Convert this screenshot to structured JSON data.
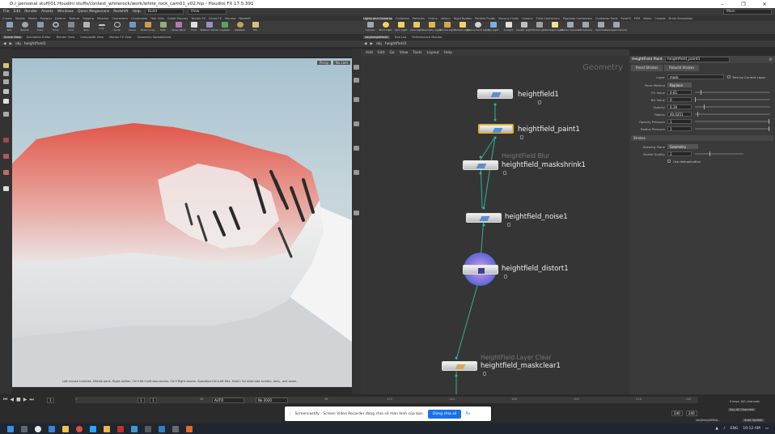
{
  "window": {
    "title": "D:/_personal stuff/01.Houdini stuffs/contest_whiterock/work/white_rock_cam01_v02.hip - Houdini FX 17.5.391",
    "controls": [
      "–",
      "❐",
      "✕"
    ]
  },
  "menubar": {
    "items": [
      "File",
      "Edit",
      "Render",
      "Assets",
      "Windows",
      "Qonsi Megascans",
      "Redshift",
      "Help"
    ],
    "desktop": "Build",
    "view": "View",
    "search": "Main"
  },
  "shelf_left": {
    "tabs": [
      "Create",
      "Modify",
      "Model",
      "Polygon",
      "Deform",
      "Texture",
      "Rigging",
      "Muscles",
      "Characters",
      "Constraints",
      "Hair Utils",
      "Guide Process",
      "Terrain FX",
      "Cloud FX",
      "Volume",
      "Redshift"
    ],
    "tools": [
      "Box",
      "Sphere",
      "Tube",
      "Torus",
      "Grid",
      "Null",
      "Line",
      "Circle",
      "Curve",
      "Draw Curve",
      "Path",
      "Spray Paint",
      "Font",
      "Platonic Solids",
      "L-System",
      "Metaball",
      "File"
    ]
  },
  "shelf_right": {
    "tabs": [
      "Lights and Cameras",
      "Collisions",
      "Particles",
      "Grains",
      "Vellum",
      "Rigid Bodies",
      "Particle Fluids",
      "Viscous Fluids",
      "Oceans",
      "Fluid Containers",
      "Populate Containers",
      "Container Tools",
      "PyroFX",
      "FEM",
      "Wires",
      "Crowds",
      "Drive Simulation"
    ],
    "tools": [
      "Camera",
      "Point Light",
      "Spot Light",
      "Area Light",
      "Geometry Light",
      "Volume Light",
      "Distant Light",
      "Environment Light",
      "Sky Light",
      "GI Light",
      "Caustic Light",
      "Portal Light",
      "Ambient Light",
      "Stereo Camera",
      "VR Camera",
      "Switcher",
      "Gamepad Camera"
    ]
  },
  "viewport": {
    "tabs": [
      "Scene View",
      "Animation Editor",
      "Render View",
      "Composite View",
      "Motion FX View",
      "Geometry Spreadsheet"
    ],
    "path": [
      "obj",
      "heightfield1"
    ],
    "label": "View",
    "persp": "Persp",
    "cam": "No cam",
    "status": "Left mouse tumbles. Middle pans. Right dollies. Ctrl+Alt+Left box-zooms. Ctrl+Right zooms. Spacebar-Ctrl-Left tilts. Hold L for alternate tumble, dolly, and zoom."
  },
  "network": {
    "tabs": [
      "/obj/heightfield1",
      "Tree List",
      "Performance Monitor"
    ],
    "path": [
      "obj",
      "heightfield1"
    ],
    "menu": [
      "Add",
      "Edit",
      "Go",
      "View",
      "Tools",
      "Layout",
      "Help"
    ],
    "context": "Geometry",
    "nodes": [
      {
        "name": "heightfield1",
        "type": ""
      },
      {
        "name": "heightfield_paint1",
        "type": ""
      },
      {
        "name": "heightfield_maskshrink1",
        "type": "HeightField Blur"
      },
      {
        "name": "heightfield_noise1",
        "type": ""
      },
      {
        "name": "heightfield_distort1",
        "type": ""
      },
      {
        "name": "heightfield_maskclear1",
        "type": "HeightField Layer Clear"
      }
    ]
  },
  "params": {
    "node_type": "HeightField Paint",
    "node_name": "heightfield_paint1",
    "buttons": [
      "Reset Strokes",
      "Rebuild Strokes"
    ],
    "layer_label": "Layer",
    "layer_value": "mask",
    "trim_label": "Trim by Current Layer",
    "rows": [
      {
        "label": "Paint Method",
        "value": "Replace"
      },
      {
        "label": "FG Value",
        "value": "0.65"
      },
      {
        "label": "BG Value",
        "value": "0"
      },
      {
        "label": "Opacity",
        "value": "0.19"
      },
      {
        "label": "Radius",
        "value": "40.0351"
      },
      {
        "label": "Opacity Pressure",
        "value": "1"
      },
      {
        "label": "Radius Pressure",
        "value": "1"
      }
    ],
    "section": "Strokes",
    "strokes": [
      {
        "label": "Drawing Plane",
        "value": "Geometry"
      },
      {
        "label": "Stroke Quality",
        "value": "2"
      }
    ],
    "use_deduplication": "Use deduplication"
  },
  "timeline": {
    "frame": "1",
    "start": "1",
    "end": "1",
    "fps": "AUTO",
    "fps_value": "No 2020",
    "ticks": [
      "1",
      "24",
      "48",
      "72",
      "96",
      "120",
      "144",
      "168",
      "192",
      "216",
      "240"
    ],
    "end_a": "240",
    "end_b": "240",
    "keys": "0 keys, 0/0 channels",
    "keyall": "Key All Channels",
    "autoupdate": "Auto Update",
    "path": "/obj/heightfield..."
  },
  "notification": {
    "message": "Screencastify - Screen Video Recorder đang chia sẻ màn hình của bạn.",
    "button": "Dừng chia sẻ",
    "hide": "Ẩn"
  },
  "taskbar": {
    "lang": "ENG",
    "time": "10:12 AM"
  },
  "colors": {
    "node_selected": "#d7b83a",
    "wire": "#2fb493",
    "distort": "#5b6bd6",
    "terrain_red": "#e2574b"
  }
}
